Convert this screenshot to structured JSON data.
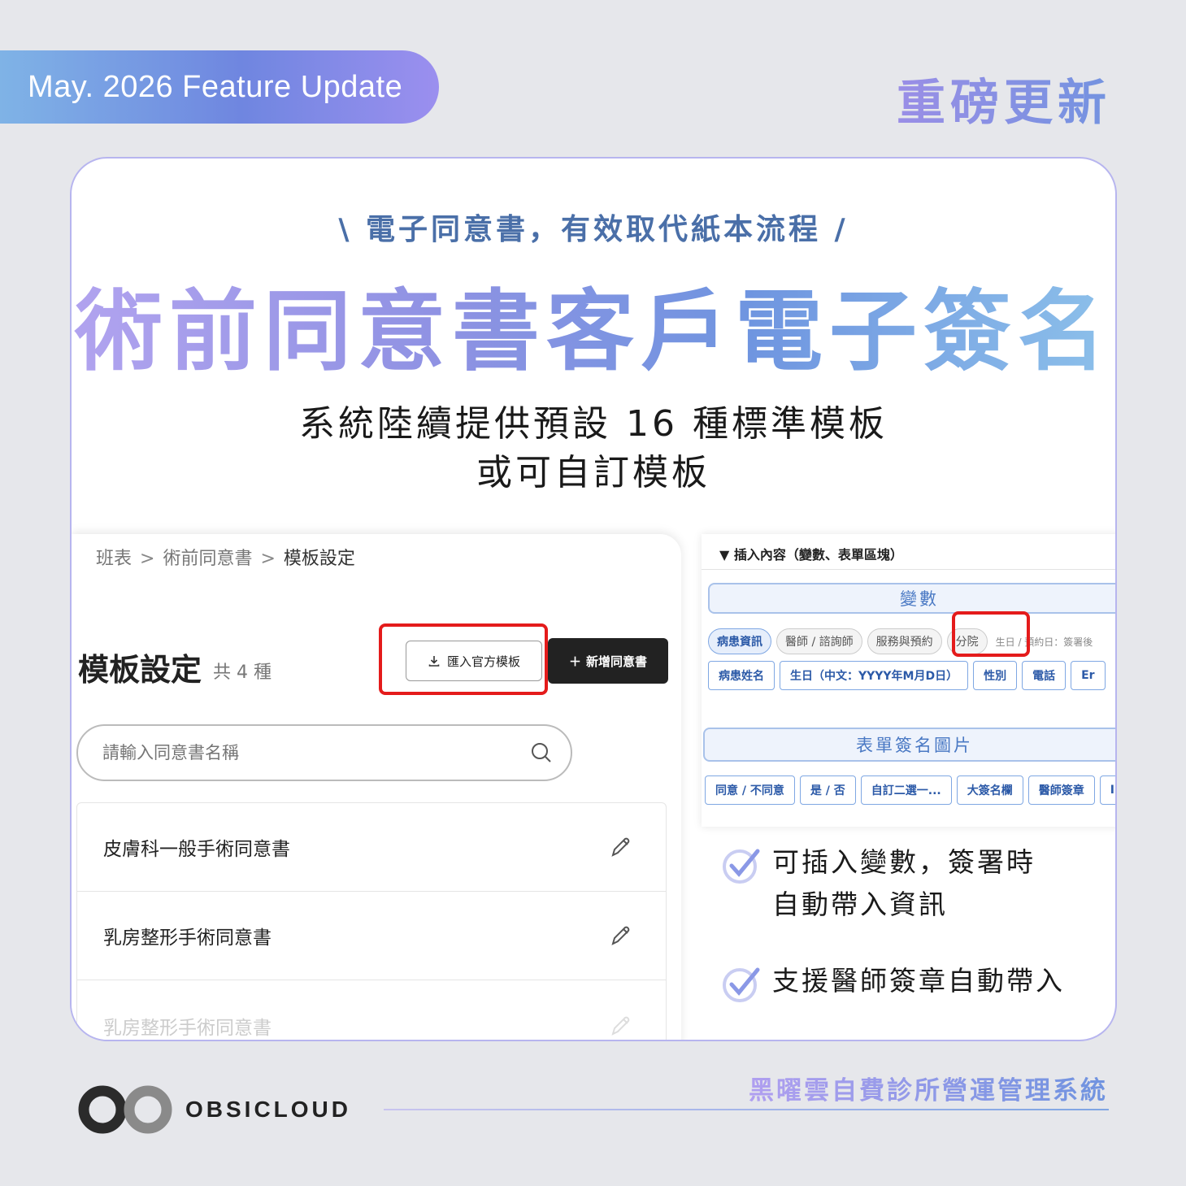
{
  "badge": "May. 2026 Feature Update",
  "headline": "重磅更新",
  "tagline": "\\ 電子同意書，有效取代紙本流程 /",
  "hero_title": "術前同意書客戶電子簽名",
  "subtitle_line1": "系統陸續提供預設 16 種標準模板",
  "subtitle_line2": "或可自訂模板",
  "left_panel": {
    "breadcrumb": [
      "班表",
      "術前同意書",
      "模板設定"
    ],
    "breadcrumb_sep": ">",
    "title": "模板設定",
    "count": "共 4 種",
    "import_button": "匯入官方模板",
    "new_button": "新增同意書",
    "search_placeholder": "請輸入同意書名稱",
    "items": [
      "皮膚科一般手術同意書",
      "乳房整形手術同意書",
      "乳房整形手術同意書"
    ]
  },
  "right_panel": {
    "header": "▼ 插入內容（變數、表單區塊）",
    "variables_label": "變數",
    "var_tabs": [
      "病患資訊",
      "醫師 / 諮詢師",
      "服務與預約",
      "分院"
    ],
    "var_hint": "生日 / 預約日：簽署後",
    "var_buttons": [
      "病患姓名",
      "生日（中文：YYYY年M月D日）",
      "性別",
      "電話",
      "Er"
    ],
    "form_label": "表單簽名圖片",
    "form_buttons": [
      "同意 / 不同意",
      "是 / 否",
      "自訂二選一...",
      "大簽名欄",
      "醫師簽章",
      "I"
    ]
  },
  "features": [
    {
      "line1": "可插入變數，簽署時",
      "line2": "自動帶入資訊"
    },
    {
      "line1": "支援醫師簽章自動帶入",
      "line2": ""
    }
  ],
  "footer": {
    "logo_text": "OBSICLOUD",
    "company": "黑曜雲自費診所營運管理系統"
  },
  "colors": {
    "accent": "#6f93df",
    "highlight_red": "#e41b1b",
    "dark_button": "#222222"
  }
}
